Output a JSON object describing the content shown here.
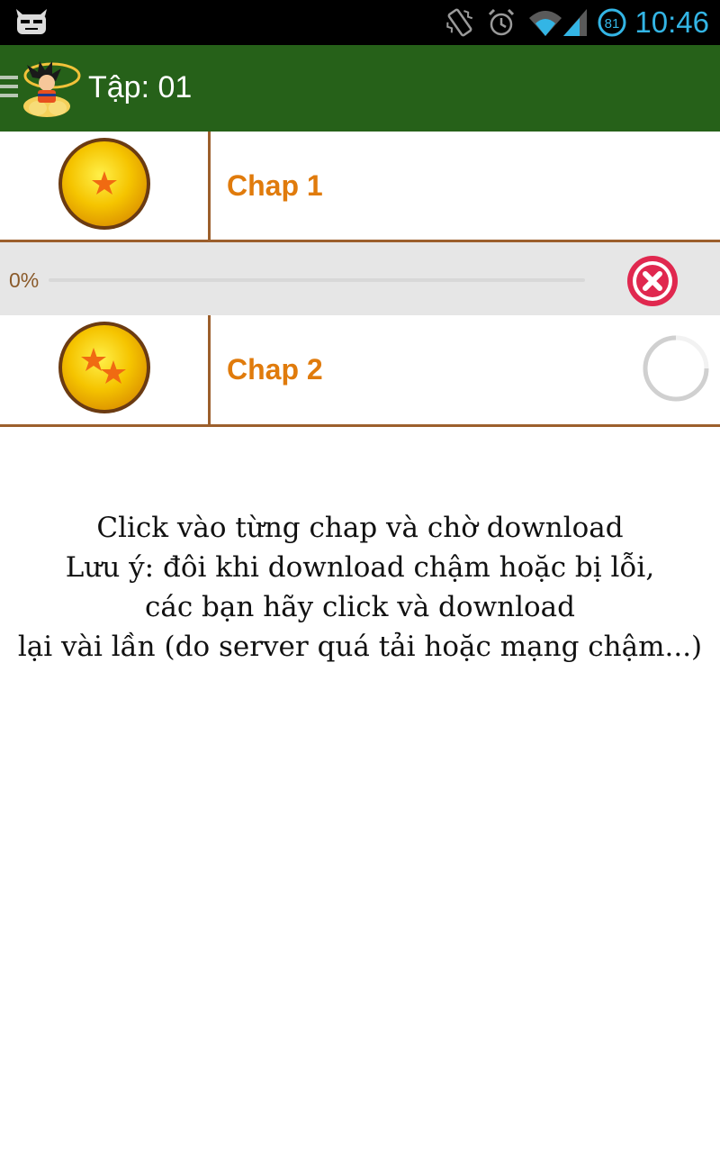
{
  "status_bar": {
    "time": "10:46",
    "battery_level": "81",
    "accent_color": "#33b5e5",
    "icons": [
      "cyanogen-robot-icon",
      "vibrate-icon",
      "alarm-icon",
      "wifi-icon",
      "signal-icon",
      "battery-icon"
    ]
  },
  "action_bar": {
    "title": "Tập: 01",
    "background_color": "#266119",
    "icons": [
      "drawer-menu-icon",
      "goku-logo-icon"
    ]
  },
  "chapters": [
    {
      "label": "Chap 1",
      "icon": "one-star-dragon-ball-icon",
      "stars": 1
    },
    {
      "label": "Chap 2",
      "icon": "two-star-dragon-ball-icon",
      "stars": 2,
      "status": "loading"
    }
  ],
  "download": {
    "percent_label": "0%",
    "progress": 0,
    "cancel_icon": "cancel-download-icon"
  },
  "message": {
    "lines": [
      "Click vào từng chap và chờ download",
      "Lưu ý: đôi khi download chậm hoặc bị lỗi,",
      "các bạn hãy click và download",
      "lại vài lần (do server quá tải hoặc mạng chậm...)"
    ]
  },
  "colors": {
    "chapter_label": "#e07b0c",
    "divider": "#9c5f2c",
    "cancel_red": "#e0284f"
  }
}
